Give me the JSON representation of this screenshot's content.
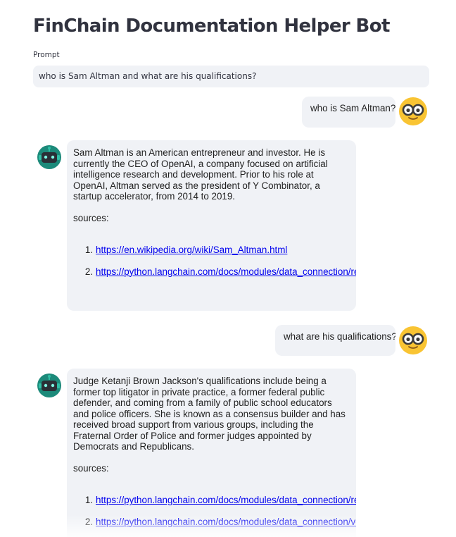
{
  "app": {
    "title": "FinChain Documentation Helper Bot"
  },
  "prompt": {
    "label": "Prompt",
    "value": "who is Sam Altman and what are his qualifications?"
  },
  "messages": [
    {
      "role": "user",
      "avatar_icon": "nerd-face-icon",
      "text": "who is Sam Altman?"
    },
    {
      "role": "assistant",
      "avatar_icon": "robot-icon",
      "text": "Sam Altman is an American entrepreneur and investor. He is currently the CEO of OpenAI, a company focused on artificial intelligence research and development. Prior to his role at OpenAI, Altman served as the president of Y Combinator, a startup accelerator, from 2014 to 2019.",
      "sources_label": "sources:",
      "sources": [
        {
          "num": "1.",
          "url": "https://en.wikipedia.org/wiki/Sam_Altman.html"
        },
        {
          "num": "2.",
          "url": "https://python.langchain.com/docs/modules/data_connection/retrievers/contextual_c"
        }
      ]
    },
    {
      "role": "user",
      "avatar_icon": "nerd-face-icon",
      "text": "what are his qualifications?"
    },
    {
      "role": "assistant",
      "avatar_icon": "robot-icon",
      "text": "Judge Ketanji Brown Jackson's qualifications include being a former top litigator in private practice, a former federal public defender, and coming from a family of public school educators and police officers. She is known as a consensus builder and has received broad support from various groups, including the Fraternal Order of Police and former judges appointed by Democrats and Republicans.",
      "sources_label": "sources:",
      "sources": [
        {
          "num": "1.",
          "url": "https://python.langchain.com/docs/modules/data_connection/retrievers/contextual_c"
        },
        {
          "num": "2.",
          "url": "https://python.langchain.com/docs/modules/data_connection/vectorstores/index.htm"
        }
      ]
    }
  ],
  "colors": {
    "bubble_bg": "#f0f2f6",
    "link": "#0000ee",
    "user_avatar": "#f9c433",
    "bot_avatar": "#1c8a7a"
  }
}
